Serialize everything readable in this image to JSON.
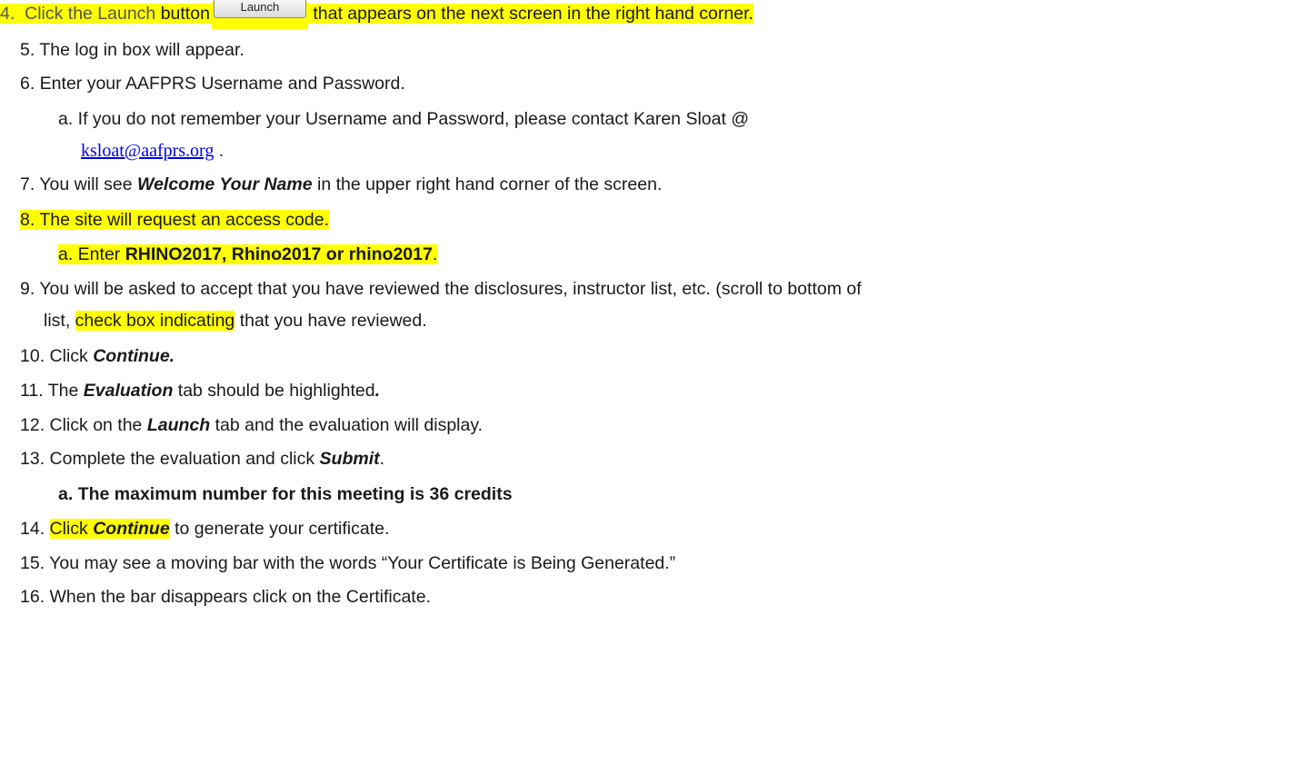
{
  "lines": [
    {
      "id": "s4",
      "num": "4.",
      "parts": [
        "Click the Launch",
        "button",
        "that appears on the next screen in the right hand corner."
      ],
      "button_label": "Launch"
    },
    {
      "id": "s5",
      "text": "5.  The log in box will appear."
    },
    {
      "id": "s6",
      "text": "6.  Enter your AAFPRS Username and Password."
    },
    {
      "id": "s6a",
      "text": "a.  If you do not remember your Username and Password, please contact Karen Sloat @",
      "link": "ksloat@aafprs.org",
      "after_link": " ."
    },
    {
      "id": "s7",
      "pre": "7.  You will see ",
      "emph": "Welcome Your Name",
      "post": " in the upper right hand corner of the screen."
    },
    {
      "id": "s8",
      "text": "8.  The site will request an access code."
    },
    {
      "id": "s8a",
      "pre": "a.  Enter ",
      "emph": "RHINO2017, Rhino2017 or rhino2017",
      "post": "."
    },
    {
      "id": "s9",
      "text": "9.  You will be asked to accept that you have reviewed the disclosures, instructor list, etc. (scroll to bottom of",
      "cont_pre": "list, ",
      "cont_hl": "check box indicating",
      "cont_post": " that you have reviewed."
    },
    {
      "id": "s10",
      "pre": "10. Click ",
      "emph": "Continue."
    },
    {
      "id": "s11",
      "pre": "11. The ",
      "emph": "Evaluation",
      "post": " tab should be highlighted",
      "tail": "."
    },
    {
      "id": "s12",
      "pre": "12. Click on the ",
      "emph": "Launch",
      "post": " tab and the evaluation will display."
    },
    {
      "id": "s13",
      "pre": "13. Complete the evaluation and click ",
      "emph": "Submit",
      "post": "."
    },
    {
      "id": "s13a",
      "text": "a.  The maximum number for this meeting is 36 credits"
    },
    {
      "id": "s14",
      "pre": "14. ",
      "hl_pre": "Click ",
      "emph": "Continue",
      "post": " to generate your certificate."
    },
    {
      "id": "s15",
      "text": "15. You may see a moving bar with the words “Your Certificate is Being Generated.”"
    },
    {
      "id": "s16",
      "text": "16. When the bar disappears click on the Certificate."
    }
  ]
}
